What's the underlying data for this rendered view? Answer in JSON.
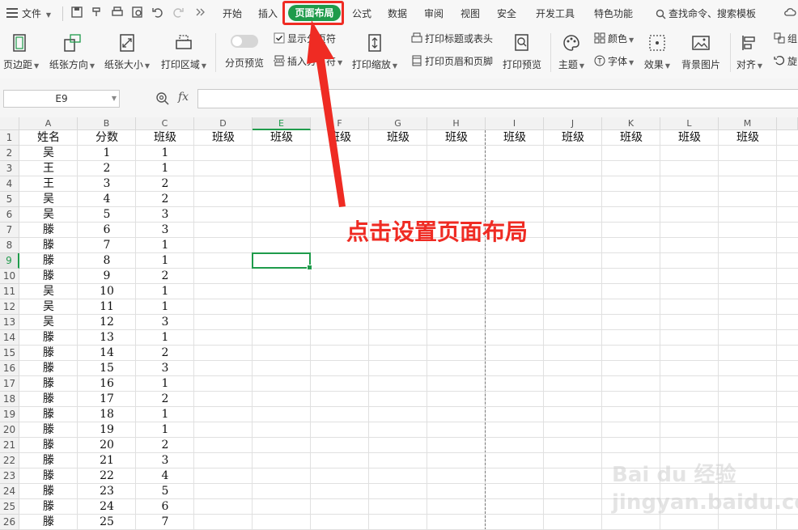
{
  "menu": {
    "file_label": "文件",
    "tabs": [
      "开始",
      "插入",
      "页面布局",
      "公式",
      "数据",
      "审阅",
      "视图",
      "安全",
      "开发工具",
      "特色功能"
    ],
    "active_tab": "页面布局",
    "search_placeholder": "查找命令、搜索模板"
  },
  "ribbon": {
    "margins": "页边距",
    "orientation": "纸张方向",
    "size": "纸张大小",
    "print_area": "打印区域",
    "page_preview": "分页预览",
    "show_page_break": "显示分页符",
    "insert_page_break": "插入分页符",
    "print_scale": "打印缩放",
    "print_titles": "打印标题或表头",
    "print_header_footer": "打印页眉和页脚",
    "print_preview": "打印预览",
    "theme": "主题",
    "colors": "颜色",
    "fonts": "字体",
    "effects": "效果",
    "background": "背景图片",
    "align": "对齐",
    "group": "组",
    "rotate": "旋"
  },
  "formula_bar": {
    "cell_ref": "E9",
    "fx": "fx",
    "formula": ""
  },
  "sheet": {
    "columns": [
      "A",
      "B",
      "C",
      "D",
      "E",
      "F",
      "G",
      "H",
      "I",
      "J",
      "K",
      "L",
      "M"
    ],
    "selected_column": "E",
    "selected_row": 9,
    "header_row": [
      "姓名",
      "分数",
      "班级",
      "班级",
      "班级",
      "班级",
      "班级",
      "班级",
      "班级",
      "班级",
      "班级",
      "班级",
      "班级"
    ],
    "rows": [
      [
        "吴",
        "1",
        "1"
      ],
      [
        "王",
        "2",
        "1"
      ],
      [
        "王",
        "3",
        "2"
      ],
      [
        "吴",
        "4",
        "2"
      ],
      [
        "吴",
        "5",
        "3"
      ],
      [
        "滕",
        "6",
        "3"
      ],
      [
        "滕",
        "7",
        "1"
      ],
      [
        "滕",
        "8",
        "1"
      ],
      [
        "滕",
        "9",
        "2"
      ],
      [
        "吴",
        "10",
        "1"
      ],
      [
        "吴",
        "11",
        "1"
      ],
      [
        "吴",
        "12",
        "3"
      ],
      [
        "滕",
        "13",
        "1"
      ],
      [
        "滕",
        "14",
        "2"
      ],
      [
        "滕",
        "15",
        "3"
      ],
      [
        "滕",
        "16",
        "1"
      ],
      [
        "滕",
        "17",
        "2"
      ],
      [
        "滕",
        "18",
        "1"
      ],
      [
        "滕",
        "19",
        "1"
      ],
      [
        "滕",
        "20",
        "2"
      ],
      [
        "滕",
        "21",
        "3"
      ],
      [
        "滕",
        "22",
        "4"
      ],
      [
        "滕",
        "23",
        "5"
      ],
      [
        "滕",
        "24",
        "6"
      ],
      [
        "滕",
        "25",
        "7"
      ]
    ]
  },
  "annotation_text": "点击设置页面布局",
  "watermark": "Bai du 经验 jingyan.baidu.com",
  "colors": {
    "accent_green": "#1f9b4b",
    "annotation_red": "#ef2b23",
    "selection_green": "#1f9b4b"
  }
}
